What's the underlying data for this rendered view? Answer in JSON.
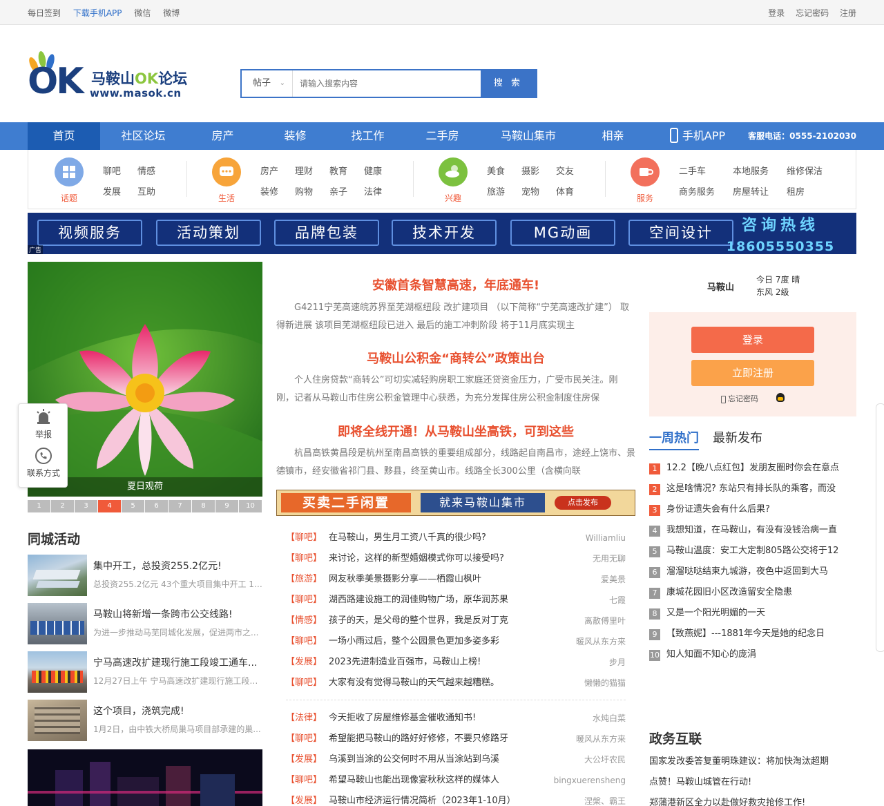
{
  "topbar": {
    "left": [
      "每日签到",
      "下载手机APP",
      "微信",
      "微博"
    ],
    "right": [
      "登录",
      "忘记密码",
      "注册"
    ]
  },
  "logo": {
    "mark": "OK",
    "title_a": "马鞍山",
    "title_b": "OK",
    "title_c": "论坛",
    "url": "www.masok.cn"
  },
  "search": {
    "type": "帖子",
    "placeholder": "请输入搜索内容",
    "button": "搜 索"
  },
  "nav": {
    "items": [
      "首页",
      "社区论坛",
      "房产",
      "装修",
      "找工作",
      "二手房",
      "马鞍山集市",
      "相亲",
      "手机APP"
    ],
    "phone": "客服电话：0555-2102030"
  },
  "categories": [
    {
      "name": "话题",
      "links": [
        "聊吧",
        "情感",
        "发展",
        "互助"
      ]
    },
    {
      "name": "生活",
      "links": [
        "房产",
        "理财",
        "教育",
        "健康",
        "装修",
        "购物",
        "亲子",
        "法律"
      ]
    },
    {
      "name": "兴趣",
      "links": [
        "美食",
        "摄影",
        "交友",
        "旅游",
        "宠物",
        "体育"
      ]
    },
    {
      "name": "服务",
      "links": [
        "二手车",
        "本地服务",
        "维修保洁",
        "商务服务",
        "房屋转让",
        "租房"
      ]
    }
  ],
  "banner": {
    "items": [
      "视频服务",
      "活动策划",
      "品牌包装",
      "技术开发",
      "MG动画",
      "空间设计"
    ],
    "hotline_label": "咨询热线",
    "hotline": "18605550355",
    "ad": "广告"
  },
  "slideshow": {
    "caption": "夏日观荷",
    "pages": [
      "1",
      "2",
      "3",
      "4",
      "5",
      "6",
      "7",
      "8",
      "9",
      "10"
    ],
    "current": 4
  },
  "float": {
    "report": "举报",
    "contact": "联系方式"
  },
  "activities": {
    "title": "同城活动",
    "items": [
      {
        "title": "集中开工，总投资255.2亿元!",
        "desc": "总投资255.2亿元 43个重大项目集中开工 1月..."
      },
      {
        "title": "马鞍山将新增一条跨市公交线路!",
        "desc": "为进一步推动马芜同城化发展，促进两市之..."
      },
      {
        "title": "宁马高速改扩建现行施工段竣工通车...",
        "desc": "12月27日上午 宁马高速改扩建现行施工段（..."
      },
      {
        "title": "这个项目，浇筑完成!",
        "desc": "1月2日，由中铁大桥局巢马项目部承建的巢..."
      }
    ]
  },
  "news": [
    {
      "title": "安徽首条智慧高速，年底通车!",
      "desc": "G4211宁芜高速皖苏界至芜湖枢纽段 改扩建项目 （以下简称“宁芜高速改扩建”） 取得新进展 该项目芜湖枢纽段已进入 最后的施工冲刺阶段 将于11月底实现主"
    },
    {
      "title": "马鞍山公积金“商转公”政策出台",
      "desc": "个人住房贷款“商转公”可切实减轻购房职工家庭还贷资金压力，广受市民关注。刚刚，记者从马鞍山市住房公积金管理中心获悉，为充分发挥住房公积金制度住房保"
    },
    {
      "title": "即将全线开通！从马鞍山坐高铁，可到这些",
      "desc": "杭昌高铁黄昌段是杭州至南昌高铁的重要组成部分，线路起自南昌市，途经上饶市、景德镇市，经安徽省祁门县、黟县，终至黄山市。线路全长300公里（含横向联"
    }
  ],
  "ad2": {
    "left": "买卖二手闲置",
    "mid": "就来马鞍山集市",
    "btn": "点击发布"
  },
  "posts1": [
    {
      "tag": "【聊吧】",
      "title": "在马鞍山，男生月工资八千真的很少吗?",
      "author": "Williamliu"
    },
    {
      "tag": "【聊吧】",
      "title": "来讨论，这样的新型婚姻模式你可以接受吗?",
      "author": "无用无聊"
    },
    {
      "tag": "【旅游】",
      "title": "网友秋季美景摄影分享——栖霞山枫叶",
      "author": "爱美景"
    },
    {
      "tag": "【聊吧】",
      "title": "湖西路建设施工的润佳购物广场，原华润苏果",
      "author": "七霞"
    },
    {
      "tag": "【情感】",
      "title": "孩子的天，是父母的整个世界，我是反对丁克",
      "author": "离散傅里叶"
    },
    {
      "tag": "【聊吧】",
      "title": "一场小雨过后，整个公园景色更加多姿多彩",
      "author": "暖风从东方来"
    },
    {
      "tag": "【发展】",
      "title": "2023先进制造业百强市，马鞍山上榜!",
      "author": "步月"
    },
    {
      "tag": "【聊吧】",
      "title": "大家有没有觉得马鞍山的天气越来越糟糕。",
      "author": "懒懒的猫猫"
    }
  ],
  "posts2": [
    {
      "tag": "【法律】",
      "title": "今天拒收了房屋维修基金催收通知书!",
      "author": "水炖白菜"
    },
    {
      "tag": "【聊吧】",
      "title": "希望能把马鞍山的路好好修修，不要只修路牙",
      "author": "暖风从东方来"
    },
    {
      "tag": "【发展】",
      "title": "乌溪到当涂的公交何时不用从当涂站到乌溪",
      "author": "大公圩农民"
    },
    {
      "tag": "【聊吧】",
      "title": "希望马鞍山也能出现像宴秋秋这样的媒体人",
      "author": "bingxuerensheng"
    },
    {
      "tag": "【发展】",
      "title": "马鞍山市经济运行情况简析（2023年1-10月）",
      "author": "涅槃、霸王"
    }
  ],
  "weather": {
    "city": "马鞍山",
    "today": "今日 7度 晴",
    "wind": "东风 2级"
  },
  "login": {
    "login": "登录",
    "register": "立即注册",
    "forgot": "忘记密码"
  },
  "hot": {
    "tabs": [
      "一周热门",
      "最新发布"
    ],
    "items": [
      "12.2【晚八点红包】发朋友圈时你会在意点",
      "这是啥情况? 东站只有排长队的乘客，而没",
      "身份证遗失会有什么后果?",
      "我想知道，在马鞍山，有没有没钱治病一直",
      "马鞍山温度：安工大定制805路公交将于12",
      "溜溜哒哒结束九城游，夜色中返回到大马",
      "康城花园旧小区改造留安全隐患",
      "又是一个阳光明媚的一天",
      "【致燕妮】---1881年今天是她的纪念日",
      "知人知面不知心的庞涓"
    ]
  },
  "gov": {
    "title": "政务互联",
    "items": [
      "国家发改委答复董明珠建议：将加快淘汰超期",
      "点赞！马鞍山城管在行动!",
      "郑蒲港新区全力以赴做好救灾抢修工作!"
    ]
  },
  "colors": {
    "nav": "#3f7dd0",
    "nav_active": "#1c5cb2",
    "accent": "#e8502f",
    "link": "#2f6fc9"
  }
}
